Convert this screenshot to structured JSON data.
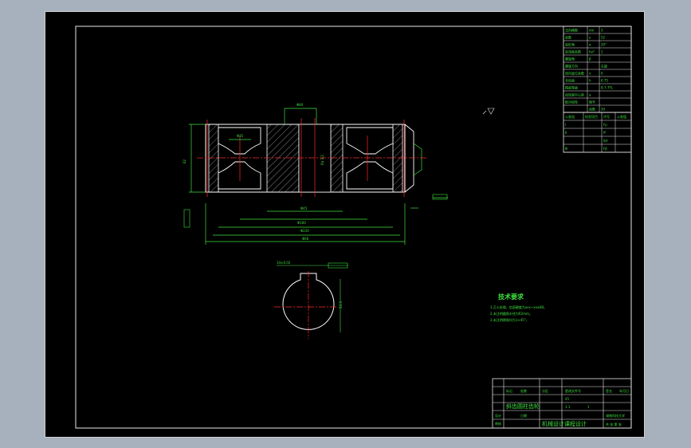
{
  "technical_requirements": {
    "title": "技术要求",
    "items": [
      "1.正火处理，齿面硬度为xxx~xxxHB。",
      "2.未注明圆角半径为R2mm。",
      "3.未注明倒角均为1×45°。"
    ]
  },
  "gear_params": {
    "rows": [
      [
        "法向模数",
        "mn",
        "3"
      ],
      [
        "齿数",
        "z",
        "52"
      ],
      [
        "齿形角",
        "α",
        "20°"
      ],
      [
        "齿顶高系数",
        "ha*",
        "1"
      ],
      [
        "螺旋角",
        "β",
        ""
      ],
      [
        "螺旋方向",
        "",
        "右旋"
      ],
      [
        "径向变位系数",
        "x",
        "0"
      ],
      [
        "全齿高",
        "h",
        "6.75"
      ],
      [
        "精度等级",
        "",
        "8-7-7FL"
      ],
      [
        "齿轮副中心距",
        "a",
        ""
      ],
      [
        "配对齿轮",
        "图号",
        ""
      ],
      [
        "",
        "齿数",
        "20"
      ]
    ],
    "tolerance_groups": [
      [
        "公差组",
        "检验项目",
        "代号",
        "公差值"
      ],
      [
        "Ⅰ",
        "",
        "Fp",
        ""
      ],
      [
        "Ⅱ",
        "",
        "ff",
        ""
      ],
      [
        "",
        "",
        "fpt",
        ""
      ],
      [
        "Ⅲ",
        "",
        "Fβ",
        ""
      ]
    ]
  },
  "title_block": {
    "part_name": "斜齿圆柱齿轮",
    "material": "45",
    "scale": "1:1",
    "quantity": "1",
    "course": "机械设计课程设计",
    "school": "湖南科技大学",
    "drawn_by_label": "设计",
    "checked_by_label": "审核",
    "date_label": "日期",
    "sheet_label": "共 张 第 张",
    "header_cells": [
      "标记",
      "处数",
      "分区",
      "更改文件号",
      "签名",
      "年月日"
    ]
  },
  "notes": {
    "surface_rough": "Ra 3.2",
    "key_width_tol": "14±0.02",
    "hub_depth": "53.3"
  },
  "colors": {
    "background": "#000000",
    "frame": "#e8e8e8",
    "dimension": "#3fe03f",
    "centerline": "#ff2a2a",
    "hatch": "#9a9a9a",
    "outline": "#ffffff"
  }
}
